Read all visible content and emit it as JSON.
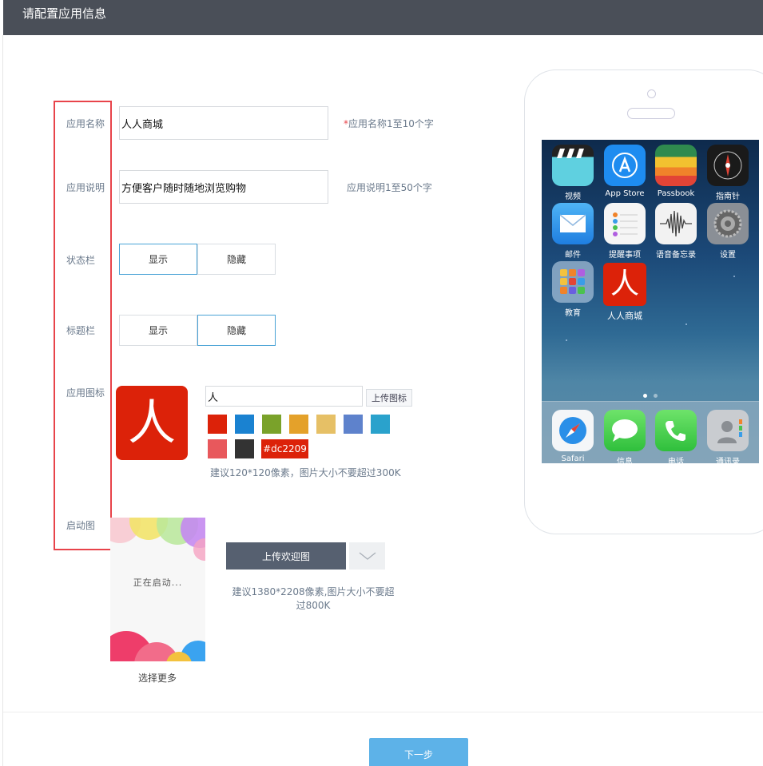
{
  "header": {
    "title": "请配置应用信息"
  },
  "form": {
    "app_name": {
      "label": "应用名称",
      "value": "人人商城",
      "hint_star": "*",
      "hint": "应用名称1至10个字"
    },
    "app_desc": {
      "label": "应用说明",
      "value": "方便客户随时随地浏览购物",
      "hint": "应用说明1至50个字"
    },
    "status_bar": {
      "label": "状态栏",
      "options": [
        "显示",
        "隐藏"
      ],
      "selected": "显示"
    },
    "title_bar": {
      "label": "标题栏",
      "options": [
        "显示",
        "隐藏"
      ],
      "selected": "隐藏"
    },
    "app_icon": {
      "label": "应用图标",
      "glyph": "人",
      "text_value": "人",
      "upload_label": "上传图标",
      "swatches": [
        "#dc2209",
        "#1a82d1",
        "#7aa22a",
        "#e4a12a",
        "#e6c066",
        "#5e82cc",
        "#2aa2cc",
        "#e8585c",
        "#333333"
      ],
      "selected_color": "#dc2209",
      "size_hint": "建议120*120像素，图片大小不要超过300K"
    },
    "splash": {
      "label": "启动图",
      "preview_text": "正在启动...",
      "more_label": "选择更多",
      "upload_label": "上传欢迎图",
      "size_hint": "建议1380*2208像素,图片大小不要超过800K"
    }
  },
  "phone": {
    "apps": [
      {
        "name": "视频",
        "icon": "video-icon",
        "color": "#5fd0e0"
      },
      {
        "name": "App Store",
        "icon": "app-store-icon",
        "color": "#1e8cf0"
      },
      {
        "name": "Passbook",
        "icon": "passbook-icon",
        "color": "#2f8a4e"
      },
      {
        "name": "指南针",
        "icon": "compass-icon",
        "color": "#222222"
      },
      {
        "name": "邮件",
        "icon": "mail-icon",
        "color": "#2a8fe8"
      },
      {
        "name": "提醒事项",
        "icon": "reminders-icon",
        "color": "#f5f5f5"
      },
      {
        "name": "语音备忘录",
        "icon": "voice-memo-icon",
        "color": "#f2f2f2"
      },
      {
        "name": "设置",
        "icon": "settings-icon",
        "color": "#8a8f96"
      },
      {
        "name": "教育",
        "icon": "folder-icon",
        "color": "#7fa3c2"
      },
      {
        "name": "人人商城",
        "icon": "store-app-icon",
        "color": "#dc2209"
      }
    ],
    "dock": [
      {
        "name": "Safari",
        "icon": "safari-icon",
        "color": "#f4f6f8"
      },
      {
        "name": "信息",
        "icon": "messages-icon",
        "color": "#3cc94a"
      },
      {
        "name": "电话",
        "icon": "phone-icon",
        "color": "#3cc94a"
      },
      {
        "name": "通讯录",
        "icon": "contacts-icon",
        "color": "#c9ccd0"
      }
    ]
  },
  "footer": {
    "next_label": "下一步"
  }
}
